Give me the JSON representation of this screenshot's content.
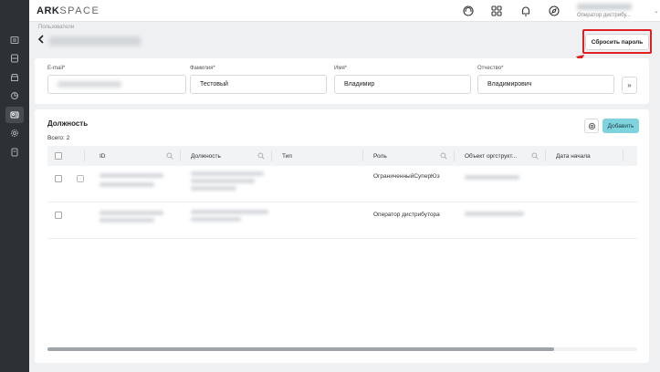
{
  "app": {
    "logo_main": "ARK",
    "logo_sub": "SPACE"
  },
  "header": {
    "icons": [
      "headset-icon",
      "apps-grid-icon",
      "bell-icon",
      "compass-icon"
    ],
    "user_role": "Оператор дистрибу..."
  },
  "breadcrumb": "Пользователи",
  "actions": {
    "reset_password": "Сбросить пароль"
  },
  "form": {
    "email_label": "E-mail*",
    "lastname_label": "Фамилия*",
    "lastname_value": "Тестовый",
    "firstname_label": "Имя*",
    "firstname_value": "Владимир",
    "patronymic_label": "Отчество*",
    "patronymic_value": "Владимирович"
  },
  "positions": {
    "title": "Должность",
    "total": "Всего: 2",
    "add_label": "Добавить",
    "columns": [
      "ID",
      "Должность",
      "Тип",
      "Роль",
      "Объект оргструкт...",
      "Дата начала"
    ],
    "rows": [
      {
        "role": "ОграниченныйСуперЮз"
      },
      {
        "role": "Оператор дистрибутора"
      }
    ]
  },
  "colors": {
    "accent": "#7fd3dc",
    "highlight": "#e02020",
    "sidebar": "#2d3035"
  }
}
